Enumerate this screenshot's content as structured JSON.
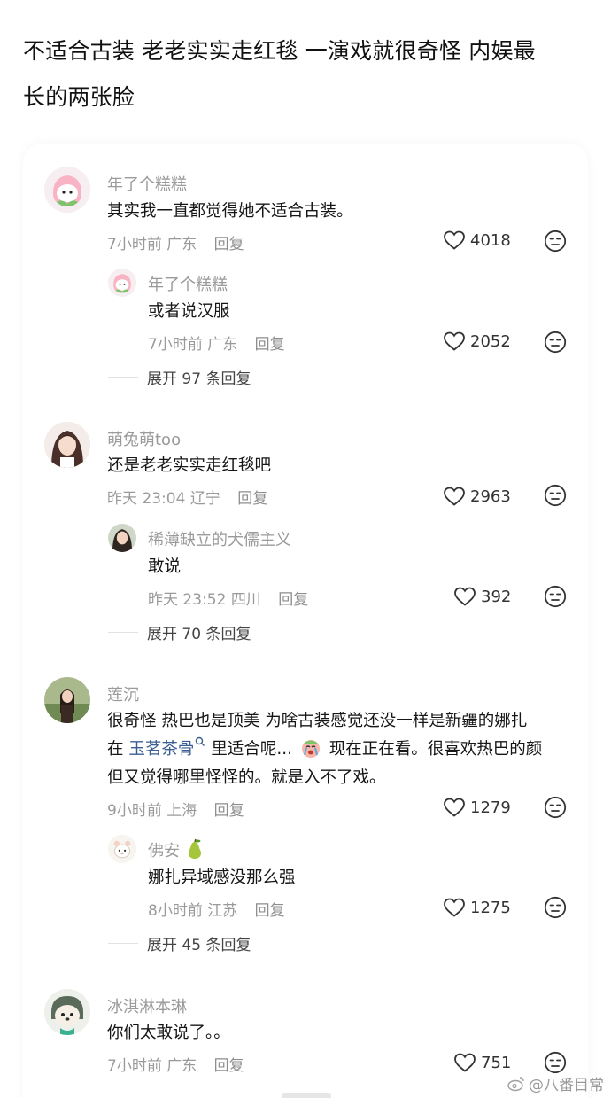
{
  "post": {
    "title_line1": "不适合古装 老老实实走红毯 一演戏就很奇怪 内娱最",
    "title_line2": "长的两张脸"
  },
  "comments": [
    {
      "username": "年了个糕糕",
      "text": "其实我一直都觉得她不适合古装。",
      "time": "7小时前",
      "location": "广东",
      "reply_label": "回复",
      "likes": "4018",
      "reply": {
        "username": "年了个糕糕",
        "text": "或者说汉服",
        "time": "7小时前",
        "location": "广东",
        "reply_label": "回复",
        "likes": "2052"
      },
      "expand_label": "展开 97 条回复"
    },
    {
      "username": "萌兔萌too",
      "text": "还是老老实实走红毯吧",
      "time": "昨天 23:04",
      "location": "辽宁",
      "reply_label": "回复",
      "likes": "2963",
      "reply": {
        "username": "稀薄缺立的犬儒主义",
        "text": "敢说",
        "time": "昨天 23:52",
        "location": "四川",
        "reply_label": "回复",
        "likes": "392"
      },
      "expand_label": "展开 70 条回复"
    },
    {
      "username": "莲沉",
      "text_line1": "很奇怪 热巴也是顶美 为啥古装感觉还没一样是新疆的娜扎",
      "text_line2_a": "在",
      "text_line2_link": "玉茗茶骨",
      "text_line2_b": "里适合呢...",
      "text_line2_c": "现在正在看。很喜欢热巴的颜",
      "text_line3": "但又觉得哪里怪怪的。就是入不了戏。",
      "time": "9小时前",
      "location": "上海",
      "reply_label": "回复",
      "likes": "1279",
      "reply": {
        "username": "佛安",
        "text": "娜扎异域感没那么强",
        "time": "8小时前",
        "location": "江苏",
        "reply_label": "回复",
        "likes": "1275"
      },
      "expand_label": "展开 45 条回复"
    },
    {
      "username": "冰淇淋本琳",
      "text": "你们太敢说了。。",
      "time": "7小时前",
      "location": "广东",
      "reply_label": "回复",
      "likes": "751"
    }
  ],
  "watermark": "@八番目常",
  "colors": {
    "username": "#9a9a9a",
    "text": "#161616",
    "link": "#3a5e92",
    "background": "#ffffff"
  },
  "icons": [
    "heart-icon",
    "dislike-face-icon",
    "search-link-icon",
    "crying-emoji-icon",
    "pear-emoji-icon",
    "weibo-logo-icon"
  ]
}
